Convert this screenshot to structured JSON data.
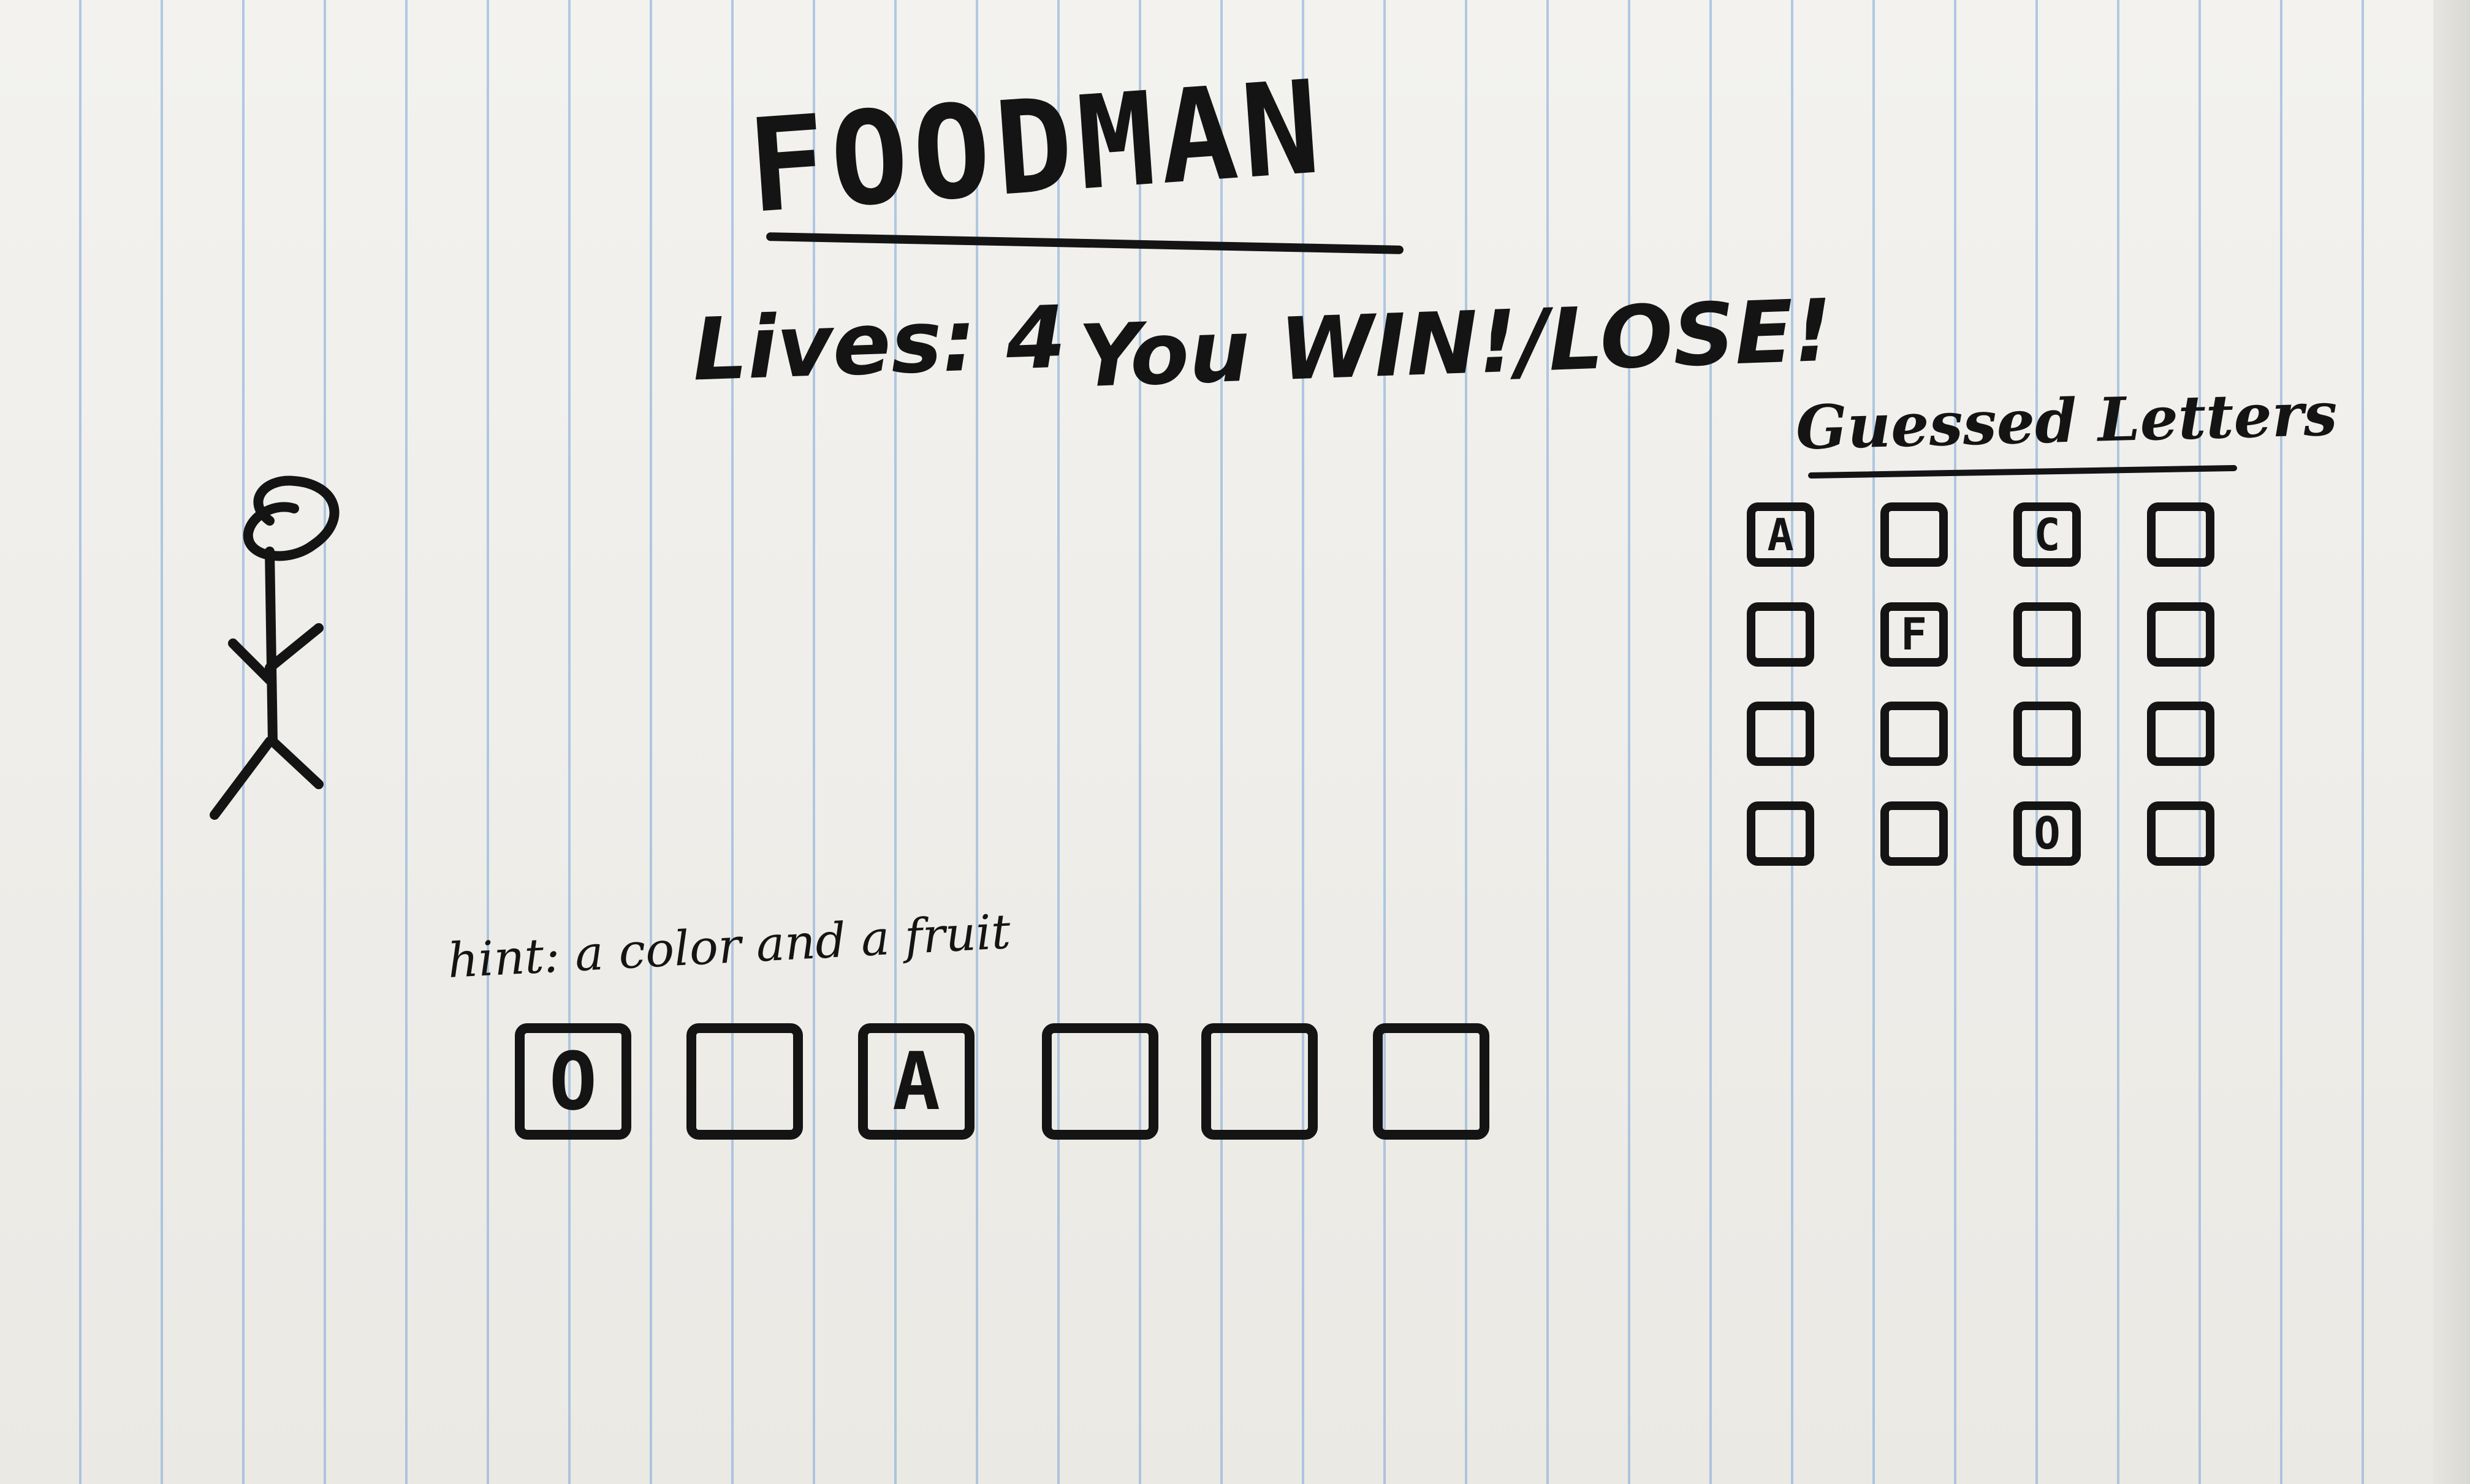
{
  "game": {
    "title": "FOODMAN",
    "lives_text": "Lives: 4",
    "outcome_text": "You WIN!/LOSE!"
  },
  "guessed_letters": {
    "heading": "Guessed Letters",
    "slots": [
      "A",
      "",
      "C",
      "",
      "",
      "F",
      "",
      "",
      "",
      "",
      "",
      "",
      "",
      "",
      "O",
      ""
    ]
  },
  "hint": "hint: a color and a fruit",
  "word_slots": [
    "O",
    "",
    "A",
    "",
    "",
    ""
  ]
}
